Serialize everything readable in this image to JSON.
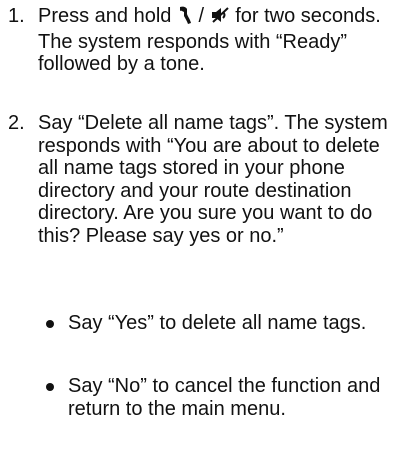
{
  "steps": [
    {
      "number": "1.",
      "text_before_icon": "Press and hold ",
      "icon_separator": " / ",
      "text_after_icon": " for two seconds. The system responds with “Ready” followed by a tone.",
      "icons": [
        "talk-button-icon",
        "mute-speaker-icon"
      ]
    },
    {
      "number": "2.",
      "text": "Say “Delete all name tags”. The system responds with “You are about to delete all name tags stored in your phone directory and your route destination directory. Are you sure you want to do this? Please say yes or no.”"
    }
  ],
  "bullets": [
    {
      "text": "Say “Yes” to delete all name tags."
    },
    {
      "text": "Say “No” to cancel the function and return to the main menu."
    }
  ]
}
